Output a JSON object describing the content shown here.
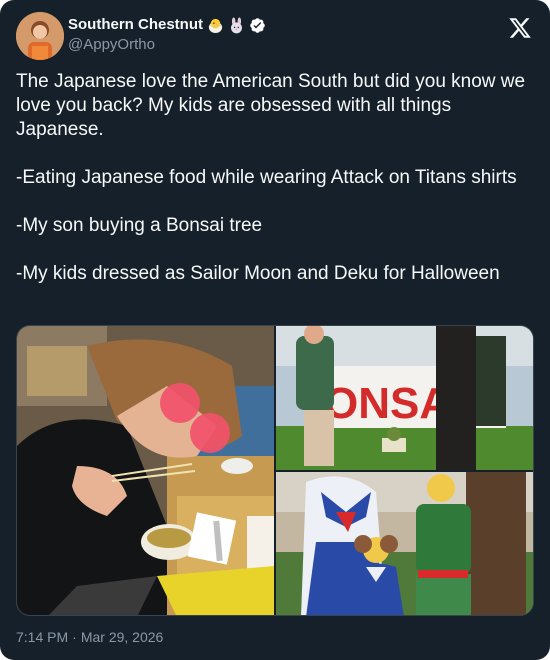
{
  "author": {
    "display_name": "Southern Chestnut",
    "handle": "@AppyOrtho",
    "badges": [
      "hatching-chick-icon",
      "rabbit-icon",
      "verified-badge-icon"
    ]
  },
  "tweet": {
    "paragraphs": [
      "The Japanese love the American South but did you know we love you back? My kids are obsessed with all things Japanese.",
      "-Eating Japanese food while wearing Attack on Titans shirts",
      "-My son buying a Bonsai tree",
      "-My kids dressed as Sailor Moon and Deku for Halloween"
    ]
  },
  "media": {
    "photos": [
      {
        "name": "photo-eating-noodles",
        "alt": ""
      },
      {
        "name": "photo-bonsai-sign",
        "sign_text": "ONSAI"
      },
      {
        "name": "photo-halloween-costumes",
        "alt": ""
      }
    ]
  },
  "meta": {
    "time": "7:14 PM",
    "separator": "·",
    "date": "Mar 29, 2026"
  },
  "colors": {
    "background": "#15202b",
    "text": "#f7f9f9",
    "secondary": "#8b98a5",
    "verified": "#ffffff"
  }
}
